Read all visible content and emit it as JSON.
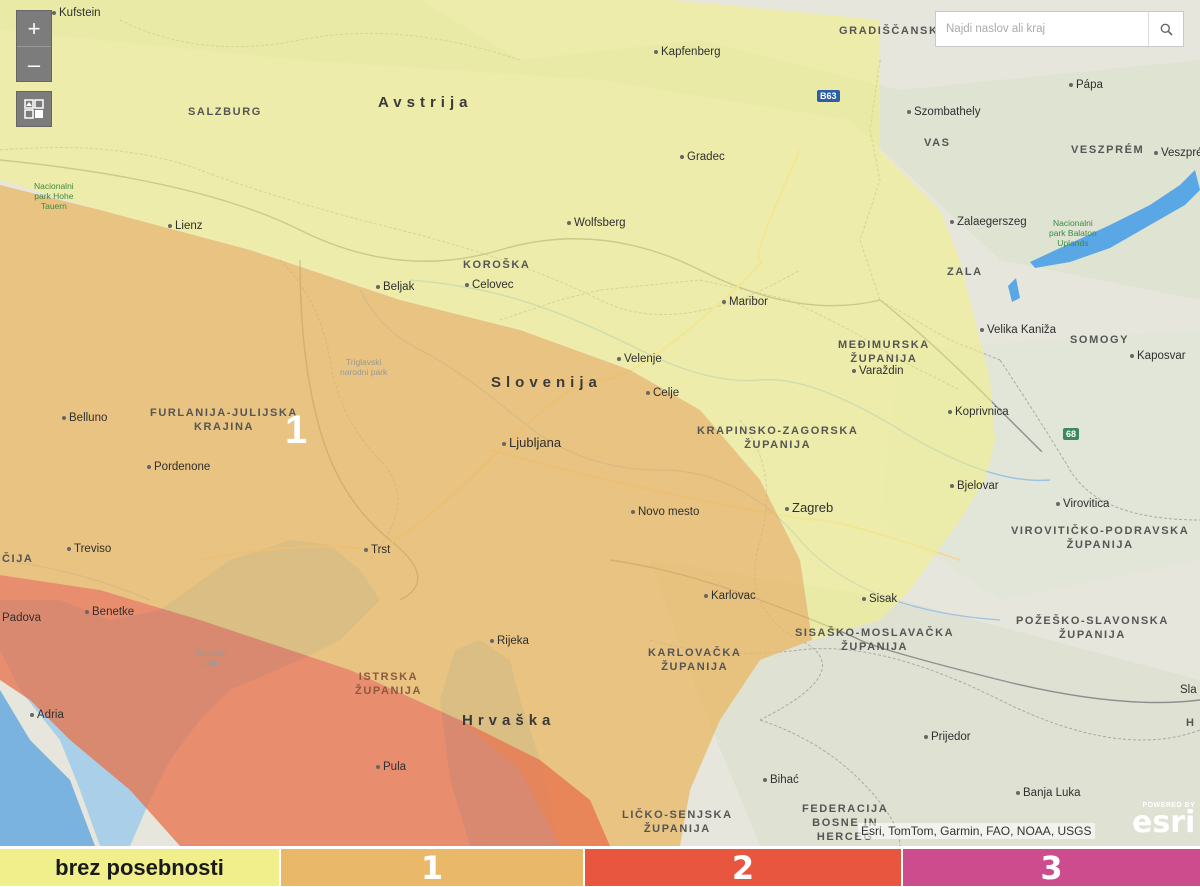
{
  "search": {
    "placeholder": "Najdi naslov ali kraj"
  },
  "zoom": {
    "in_label": "+",
    "out_label": "–"
  },
  "zones": {
    "none": {
      "color": "#f1ef8c"
    },
    "z1": {
      "label": "1",
      "color": "#e9b868"
    },
    "z2": {
      "label": "2",
      "color": "#e8754f"
    },
    "z3": {
      "label": "3",
      "color": "#c94b8a"
    }
  },
  "countries": {
    "austria": "Avstrija",
    "slovenia": "Slovenija",
    "croatia": "Hrvaška"
  },
  "regions": {
    "salzburg": "SALZBURG",
    "koroska": "KOROŠKA",
    "friuli": "FURLANIJA-JULIJSKA\nKRAJINA",
    "medjimurje": "MEĐIMURSKA\nŽUPANIJA",
    "krapina": "KRAPINSKO-ZAGORSKA\nŽUPANIJA",
    "virovitica_region": "VIROVITIČKO-PODRAVSKA\nŽUPANIJA",
    "pozega": "POŽEŠKO-SLAVONSKA\nŽUPANIJA",
    "sisak_region": "SISAŠKO-MOSLAVAČKA\nŽUPANIJA",
    "karlovac_region": "KARLOVAČKA\nŽUPANIJA",
    "istria": "ISTRSKA\nŽUPANIJA",
    "lika": "LIČKO-SENJSKA\nŽUPANIJA",
    "federacija": "FEDERACIJA\nBOSNE IN\nHERCEG",
    "vas": "VAS",
    "zala": "ZALA",
    "veszprem": "VESZPRÉM",
    "somogy": "SOMOGY",
    "gradiscansk": "GRADIŠČANSK",
    "cija": "ČIJA",
    "h_edge": "H"
  },
  "cities": {
    "kufstein": "Kufstein",
    "kapfenberg": "Kapfenberg",
    "gradec": "Gradec",
    "lienz": "Lienz",
    "wolfsberg": "Wolfsberg",
    "beljak": "Beljak",
    "celovec": "Celovec",
    "maribor": "Maribor",
    "velenje": "Velenje",
    "celje": "Celje",
    "ljubljana": "Ljubljana",
    "novo_mesto": "Novo mesto",
    "zagreb": "Zagreb",
    "karlovac": "Karlovac",
    "sisak": "Sisak",
    "rijeka": "Rijeka",
    "trst": "Trst",
    "belluno": "Belluno",
    "pordenone": "Pordenone",
    "treviso": "Treviso",
    "padova": "Padova",
    "benetke": "Benetke",
    "adria": "Adria",
    "pula": "Pula",
    "varazdin": "Varaždin",
    "koprivnica": "Koprivnica",
    "bjelovar": "Bjelovar",
    "virovitica": "Virovitica",
    "prijedor": "Prijedor",
    "bihac": "Bihać",
    "banja_luka": "Banja Luka",
    "papa": "Pápa",
    "szombathely": "Szombathely",
    "veszprem_city": "Veszprém",
    "zalaegerszeg": "Zalaegerszeg",
    "velika_kaniza": "Velika Kaniža",
    "kaposvar": "Kaposvar",
    "sla": "Sla"
  },
  "parks": {
    "hohe_tauern": "Nacionalni\npark Hohe\nTauern",
    "balaton": "Nacionalni\npark Balaton\nUplands",
    "triglav": "Triglavski\nnarodni park",
    "benesk": "Beneški\nzaliv"
  },
  "roads": {
    "b63": "B63",
    "r68": "68"
  },
  "zone_marker": "1",
  "attribution": "Esri, TomTom, Garmin, FAO, NOAA, USGS",
  "esri": {
    "powered": "POWERED BY",
    "name": "esri"
  },
  "legend": [
    {
      "label": "brez posebnosti",
      "color": "#f1ef8c",
      "text_color": "#1a1a1a"
    },
    {
      "label": "1",
      "color": "#e9b868",
      "text_color": "#ffffff"
    },
    {
      "label": "2",
      "color": "#e8563f",
      "text_color": "#ffffff"
    },
    {
      "label": "3",
      "color": "#cc4c8e",
      "text_color": "#ffffff"
    }
  ]
}
